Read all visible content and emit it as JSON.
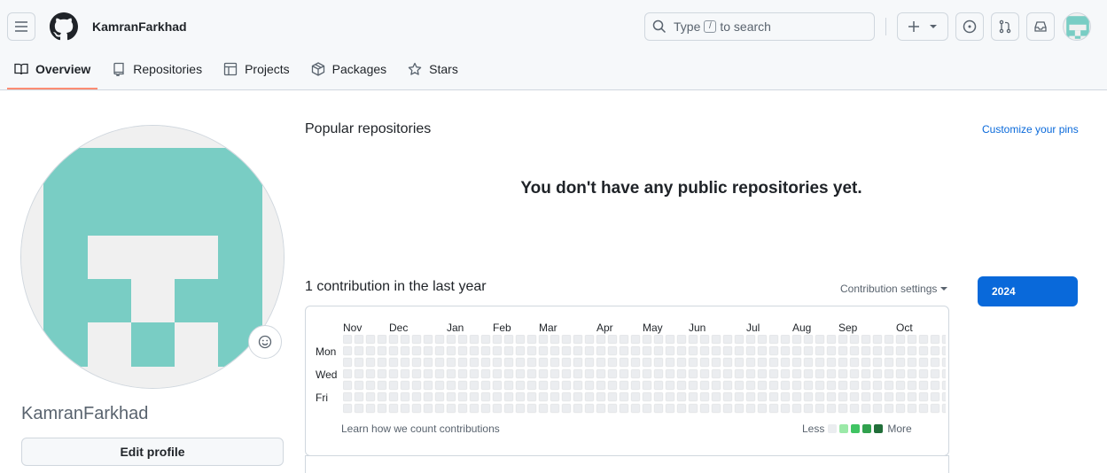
{
  "header": {
    "context_name": "KamranFarkhad",
    "search_prefix": "Type",
    "search_key": "/",
    "search_suffix": "to search"
  },
  "tabs": [
    {
      "label": "Overview",
      "icon": "book-icon",
      "active": true
    },
    {
      "label": "Repositories",
      "icon": "repo-icon"
    },
    {
      "label": "Projects",
      "icon": "table-icon"
    },
    {
      "label": "Packages",
      "icon": "package-icon"
    },
    {
      "label": "Stars",
      "icon": "star-icon"
    }
  ],
  "profile": {
    "username": "KamranFarkhad",
    "edit_label": "Edit profile"
  },
  "main": {
    "popular_title": "Popular repositories",
    "customize_label": "Customize your pins",
    "empty_message": "You don't have any public repositories yet."
  },
  "contributions": {
    "summary": "1 contribution in the last year",
    "settings_label": "Contribution settings",
    "year_label": "2024",
    "months": [
      "Nov",
      "Dec",
      "Jan",
      "Feb",
      "Mar",
      "Apr",
      "May",
      "Jun",
      "Jul",
      "Aug",
      "Sep",
      "Oct"
    ],
    "day_labels": [
      "Mon",
      "Wed",
      "Fri"
    ],
    "learn_link": "Learn how we count contributions",
    "legend_less": "Less",
    "legend_more": "More",
    "legend_colors": [
      "#ebedf0",
      "#9be9a8",
      "#40c463",
      "#30a14e",
      "#216e39"
    ],
    "empty_cell_color": "#ebedf0",
    "weeks": 53,
    "days_per_week": 7
  },
  "colors": {
    "accent": "#0969da",
    "tab_underline": "#fd8c73",
    "identicon": "#79cdc4"
  }
}
